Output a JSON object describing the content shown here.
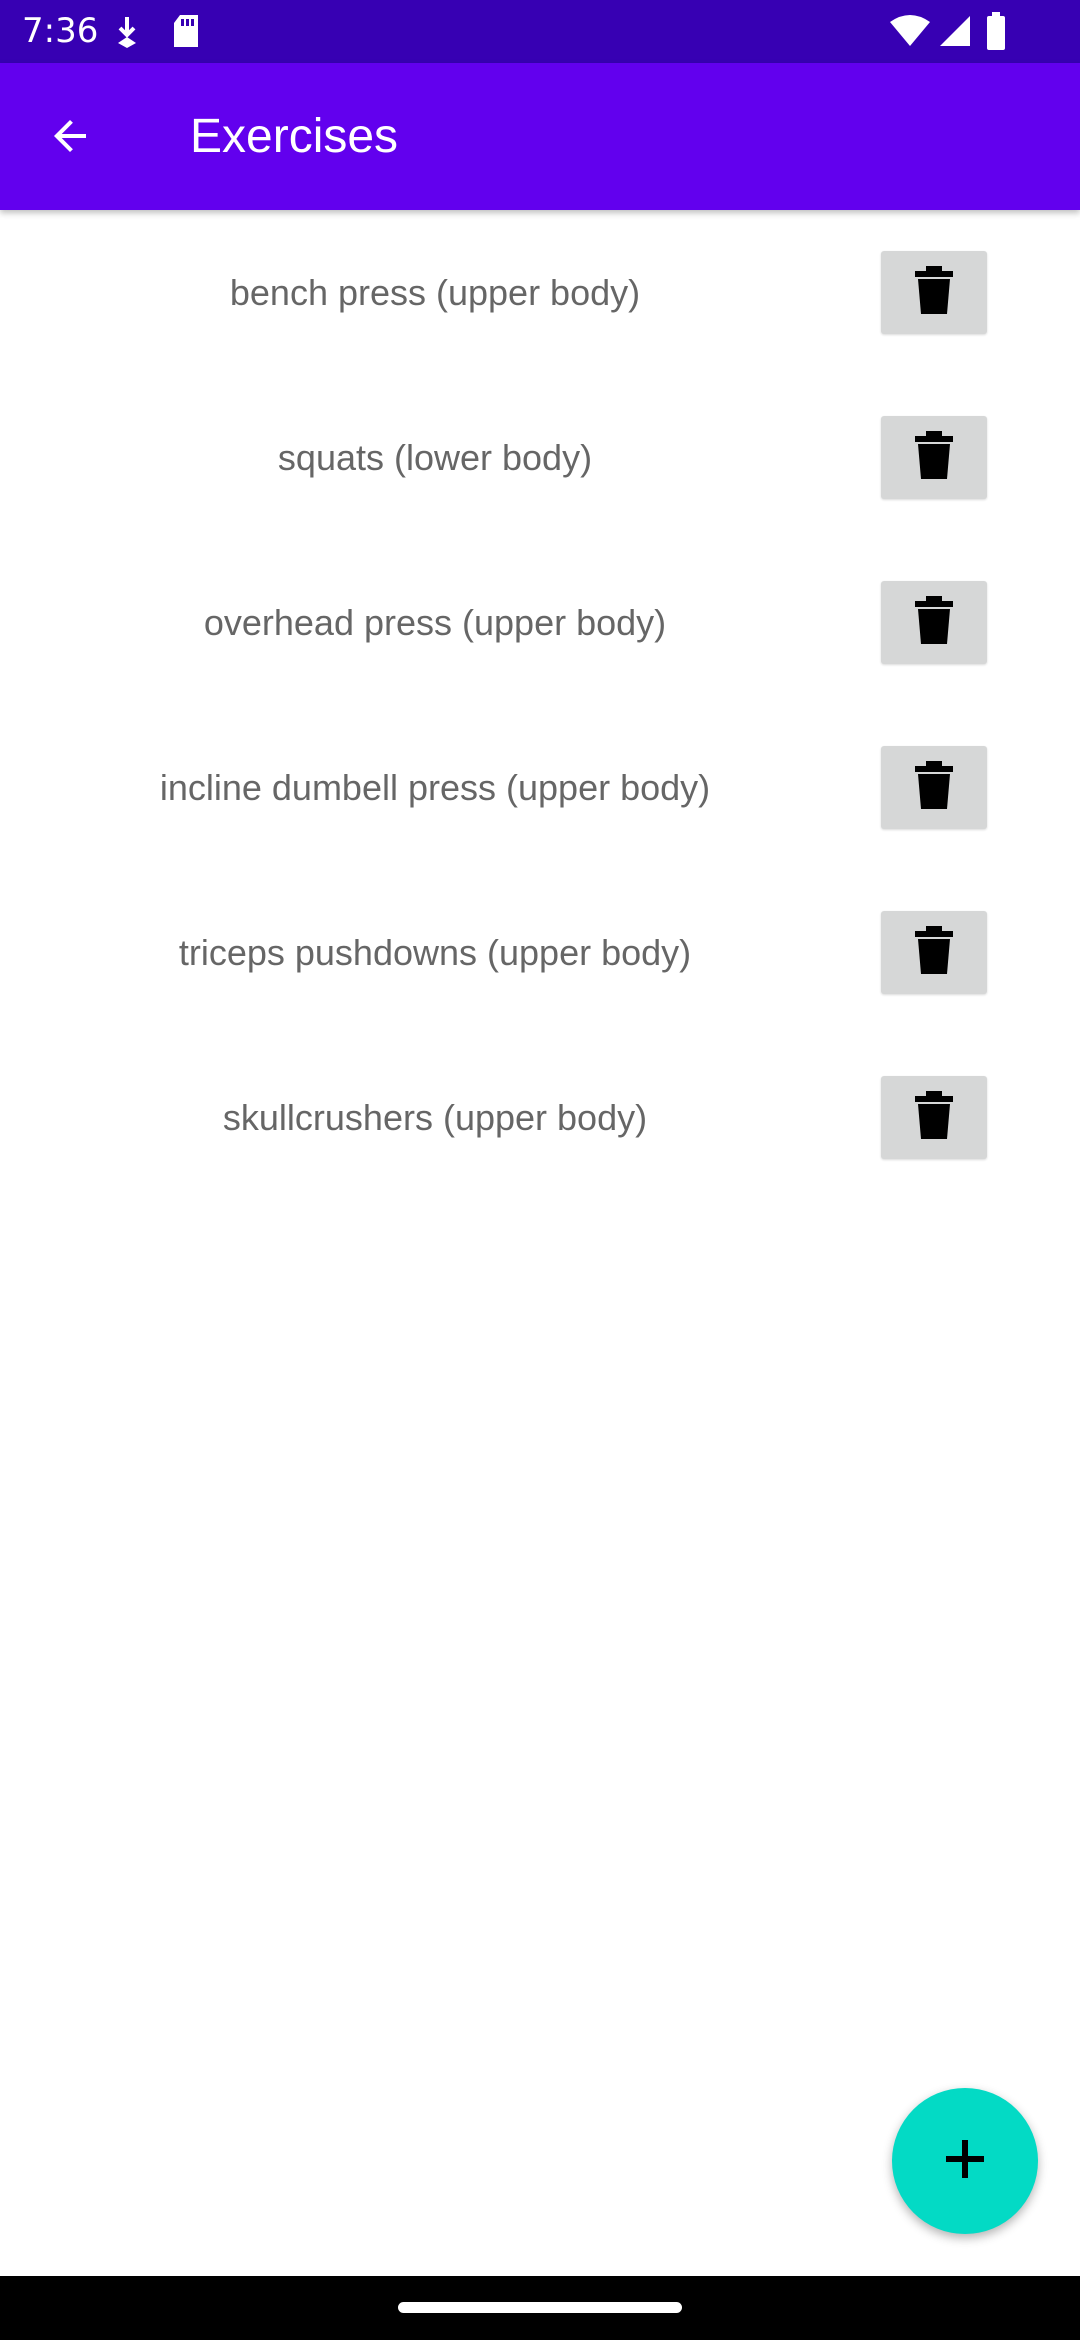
{
  "status_bar": {
    "time": "7:36",
    "icons": [
      "download-indicator-icon",
      "sd-card-icon",
      "wifi-icon",
      "cellular-signal-icon",
      "battery-icon"
    ]
  },
  "app_bar": {
    "title": "Exercises",
    "back_icon": "arrow-back-icon",
    "color": "#6200ee"
  },
  "exercises": [
    {
      "label": "bench press (upper body)"
    },
    {
      "label": "squats (lower body)"
    },
    {
      "label": "overhead press (upper body)"
    },
    {
      "label": "incline dumbell press (upper body)"
    },
    {
      "label": "triceps pushdowns (upper body)"
    },
    {
      "label": "skullcrushers (upper body)"
    }
  ],
  "delete_icon": "trash-icon",
  "fab": {
    "icon": "plus-icon",
    "color": "#03dac5"
  },
  "colors": {
    "status_bar": "#3700b3",
    "primary": "#6200ee",
    "accent": "#03dac5",
    "delete_button_bg": "#d6d7d7",
    "list_text": "#666666"
  }
}
